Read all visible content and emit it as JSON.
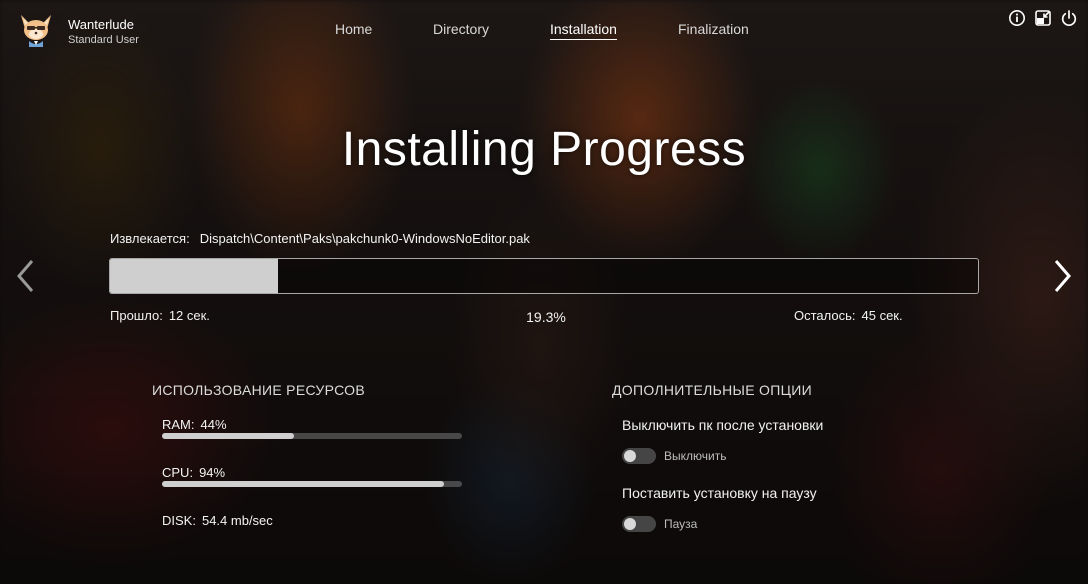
{
  "user": {
    "name": "Wanterlude",
    "role": "Standard User",
    "avatar_icon": "fox-mascot-icon"
  },
  "nav": {
    "items": [
      {
        "label": "Home",
        "active": false
      },
      {
        "label": "Directory",
        "active": false
      },
      {
        "label": "Installation",
        "active": true
      },
      {
        "label": "Finalization",
        "active": false
      }
    ]
  },
  "top_icons": [
    "info-icon",
    "window-minimize-icon",
    "power-icon"
  ],
  "title": "Installing Progress",
  "extract": {
    "label": "Извлекается:",
    "path": "Dispatch\\Content\\Paks\\pakchunk0-WindowsNoEditor.pak"
  },
  "progress": {
    "fraction": 0.193,
    "percent_text": "19.3%",
    "elapsed_label": "Прошло:",
    "elapsed_value": "12 сек.",
    "remaining_label": "Осталось:",
    "remaining_value": "45 сек."
  },
  "arrows": {
    "left": "chevron-left-icon",
    "right": "chevron-right-icon"
  },
  "resources": {
    "title": "ИСПОЛЬЗОВАНИЕ РЕСУРСОВ",
    "ram": {
      "label": "RAM:",
      "value": "44%",
      "fraction": 0.44
    },
    "cpu": {
      "label": "CPU:",
      "value": "94%",
      "fraction": 0.94
    },
    "disk": {
      "label": "DISK:",
      "value": "54.4 mb/sec"
    }
  },
  "options": {
    "title": "ДОПОЛНИТЕЛЬНЫЕ ОПЦИИ",
    "shutdown": {
      "label": "Выключить пк после установки",
      "toggle_text": "Выключить",
      "on": false
    },
    "pause": {
      "label": "Поставить установку на паузу",
      "toggle_text": "Пауза",
      "on": false
    }
  },
  "colors": {
    "accent": "#ffffff",
    "fill": "#cfcfcf",
    "track": "#5a5a5a"
  }
}
